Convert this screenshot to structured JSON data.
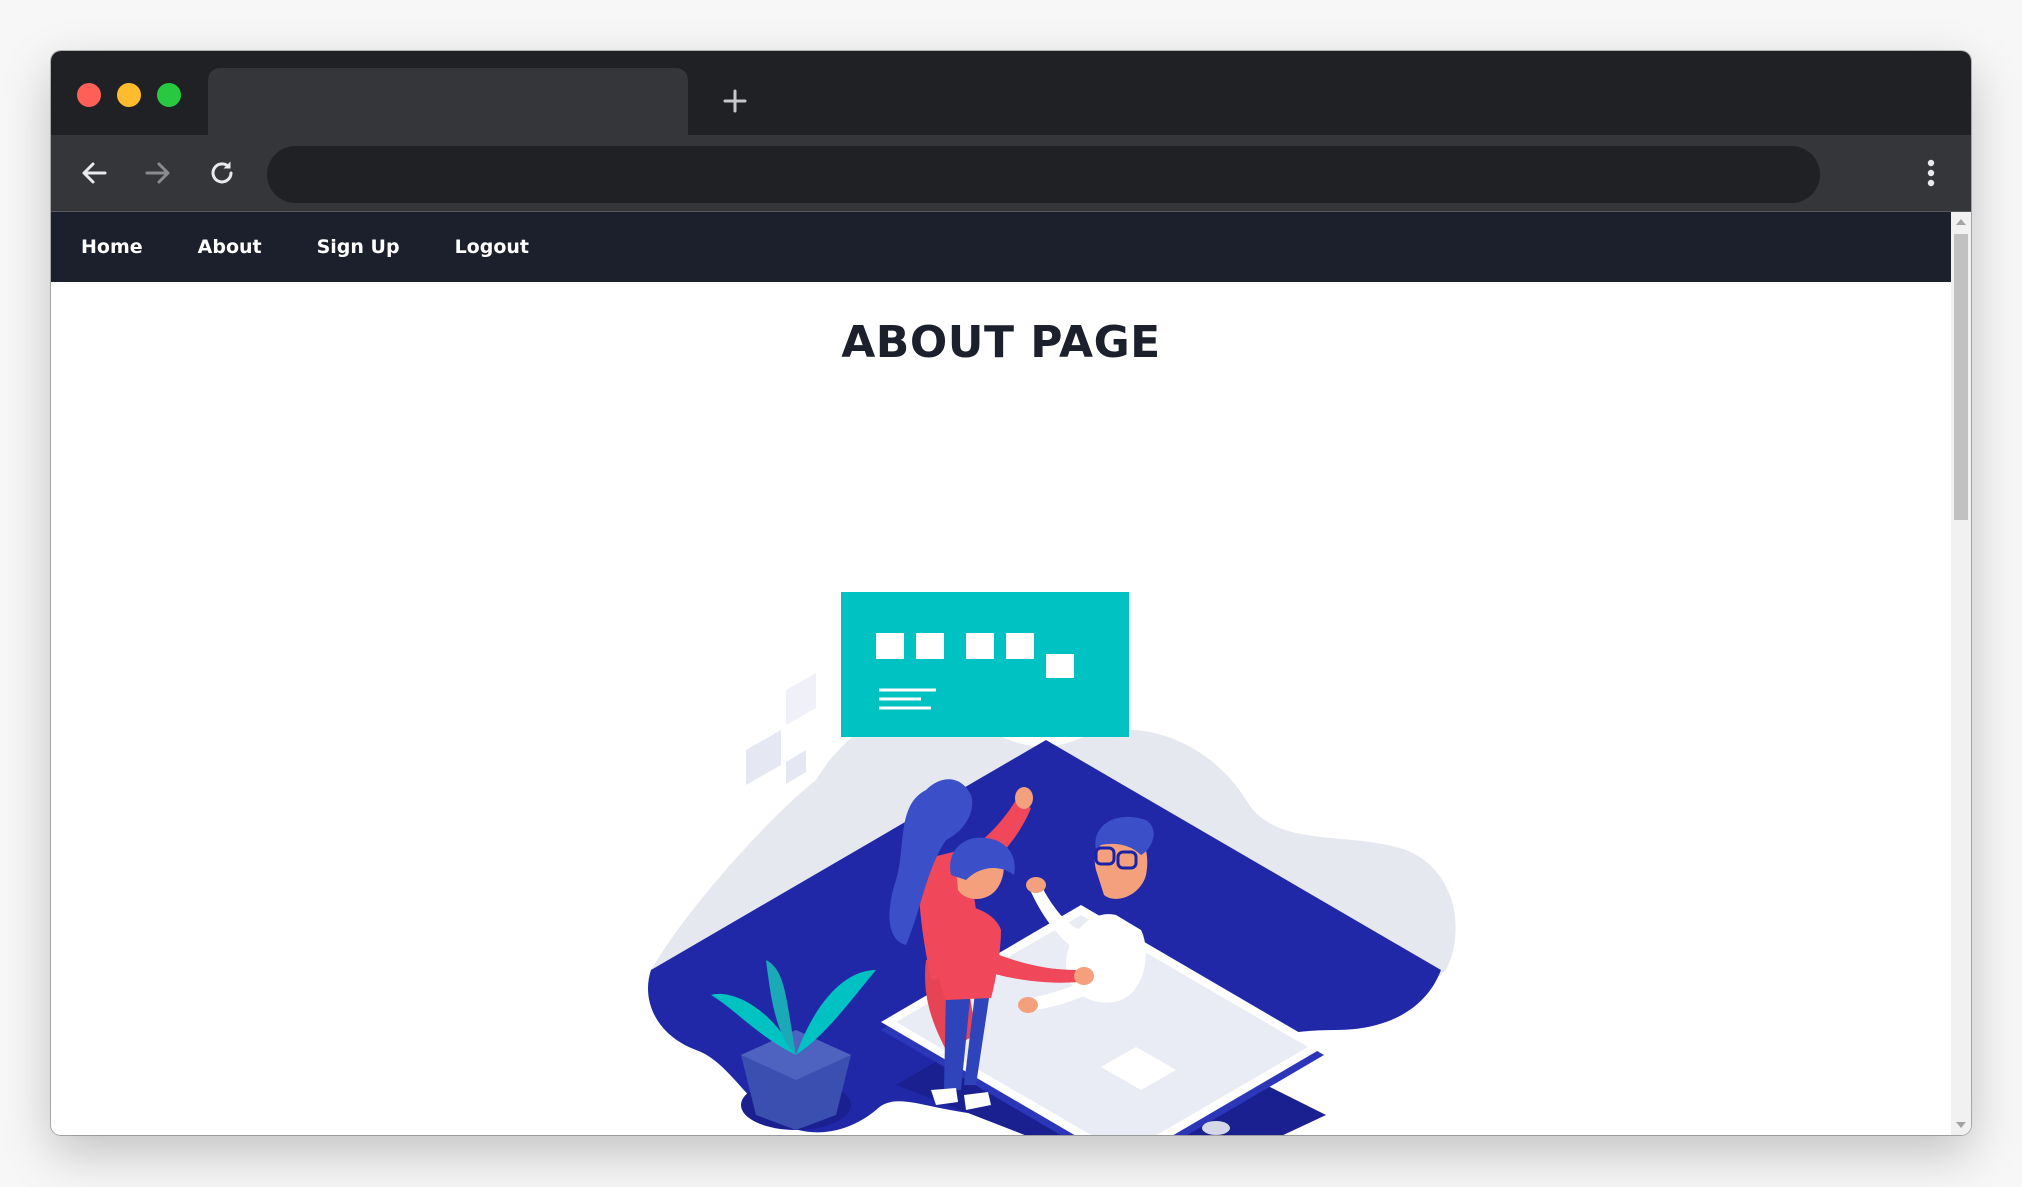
{
  "browser": {
    "tab_title": "",
    "address": "",
    "new_tab_icon": "plus-icon",
    "back_icon": "arrow-left-icon",
    "forward_icon": "arrow-right-icon",
    "reload_icon": "reload-icon",
    "menu_icon": "kebab-menu-icon"
  },
  "nav": {
    "items": [
      {
        "label": "Home"
      },
      {
        "label": "About"
      },
      {
        "label": "Sign Up"
      },
      {
        "label": "Logout"
      }
    ]
  },
  "page": {
    "title": "ABOUT PAGE"
  },
  "colors": {
    "navbar": "#1b202c",
    "blob_blue": "#2128a8",
    "board_teal": "#00c2c2",
    "shirt_red": "#f0485a",
    "hair_blue": "#3a4fc8"
  }
}
